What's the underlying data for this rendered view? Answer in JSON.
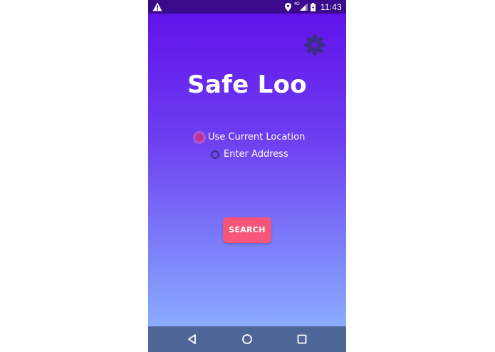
{
  "status_bar": {
    "time": "11:43",
    "network_type": "4G",
    "icons": [
      "warning-icon",
      "location-icon",
      "signal-icon",
      "battery-icon"
    ]
  },
  "app": {
    "title": "Safe Loo",
    "settings_icon": "gear-icon",
    "radio_options": [
      {
        "label": "Use Current Location",
        "checked": true
      },
      {
        "label": "Enter Address",
        "checked": false
      }
    ],
    "search_button_label": "SEARCH"
  },
  "nav_bar": {
    "icons": [
      "back-icon",
      "home-icon",
      "recents-icon"
    ]
  },
  "colors": {
    "status_bar": "#3a0a8c",
    "gradient_top": "#6112ea",
    "gradient_bottom": "#8aabff",
    "accent": "#f5567a",
    "radio_checked": "#e8316d",
    "settings_icon": "#3c2e86",
    "nav_bar": "#4e6598"
  }
}
